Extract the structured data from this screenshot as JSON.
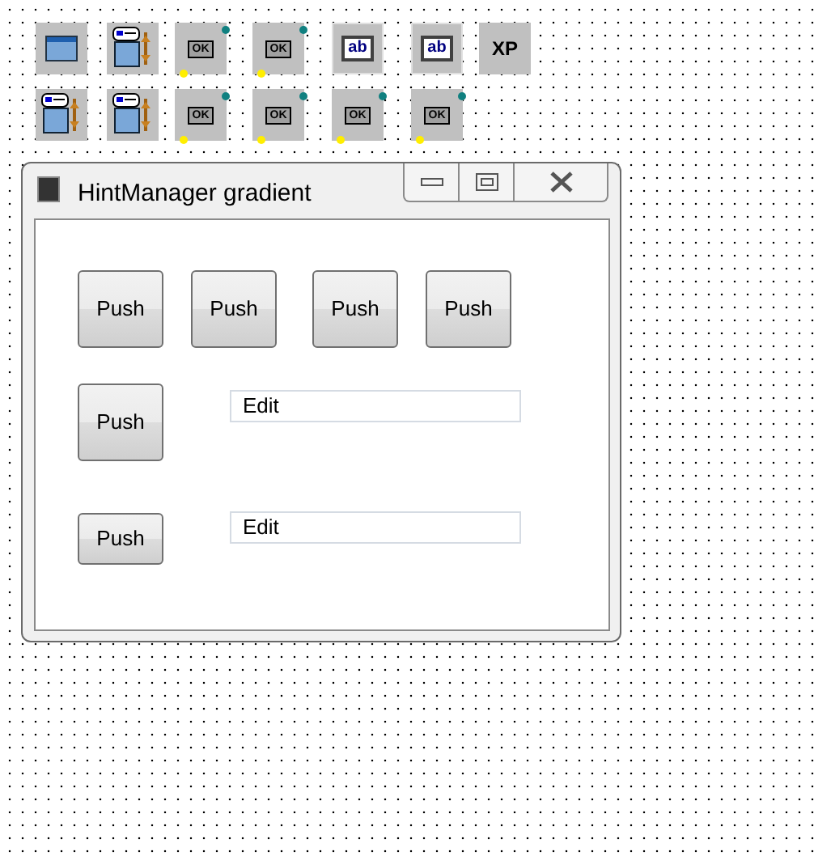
{
  "palette": [
    [
      {
        "kind": "form"
      },
      {
        "kind": "hint"
      },
      {
        "kind": "button",
        "label": "OK"
      },
      {
        "kind": "button",
        "label": "OK"
      },
      {
        "kind": "edit",
        "label": "ab"
      },
      {
        "kind": "edit",
        "label": "ab"
      },
      {
        "kind": "xp",
        "label": "XP"
      }
    ],
    [
      {
        "kind": "hint"
      },
      {
        "kind": "hint"
      },
      {
        "kind": "button",
        "label": "OK"
      },
      {
        "kind": "button",
        "label": "OK"
      },
      {
        "kind": "button",
        "label": "OK"
      },
      {
        "kind": "button",
        "label": "OK"
      }
    ]
  ],
  "window": {
    "title": "HintManager gradient"
  },
  "controls": [
    {
      "kind": "button",
      "label": "Push"
    },
    {
      "kind": "button",
      "label": "Push"
    },
    {
      "kind": "button",
      "label": "Push"
    },
    {
      "kind": "button",
      "label": "Push"
    },
    {
      "kind": "button",
      "label": "Push"
    },
    {
      "kind": "edit",
      "value": "Edit"
    },
    {
      "kind": "button",
      "label": "Push"
    },
    {
      "kind": "edit",
      "value": "Edit"
    }
  ]
}
